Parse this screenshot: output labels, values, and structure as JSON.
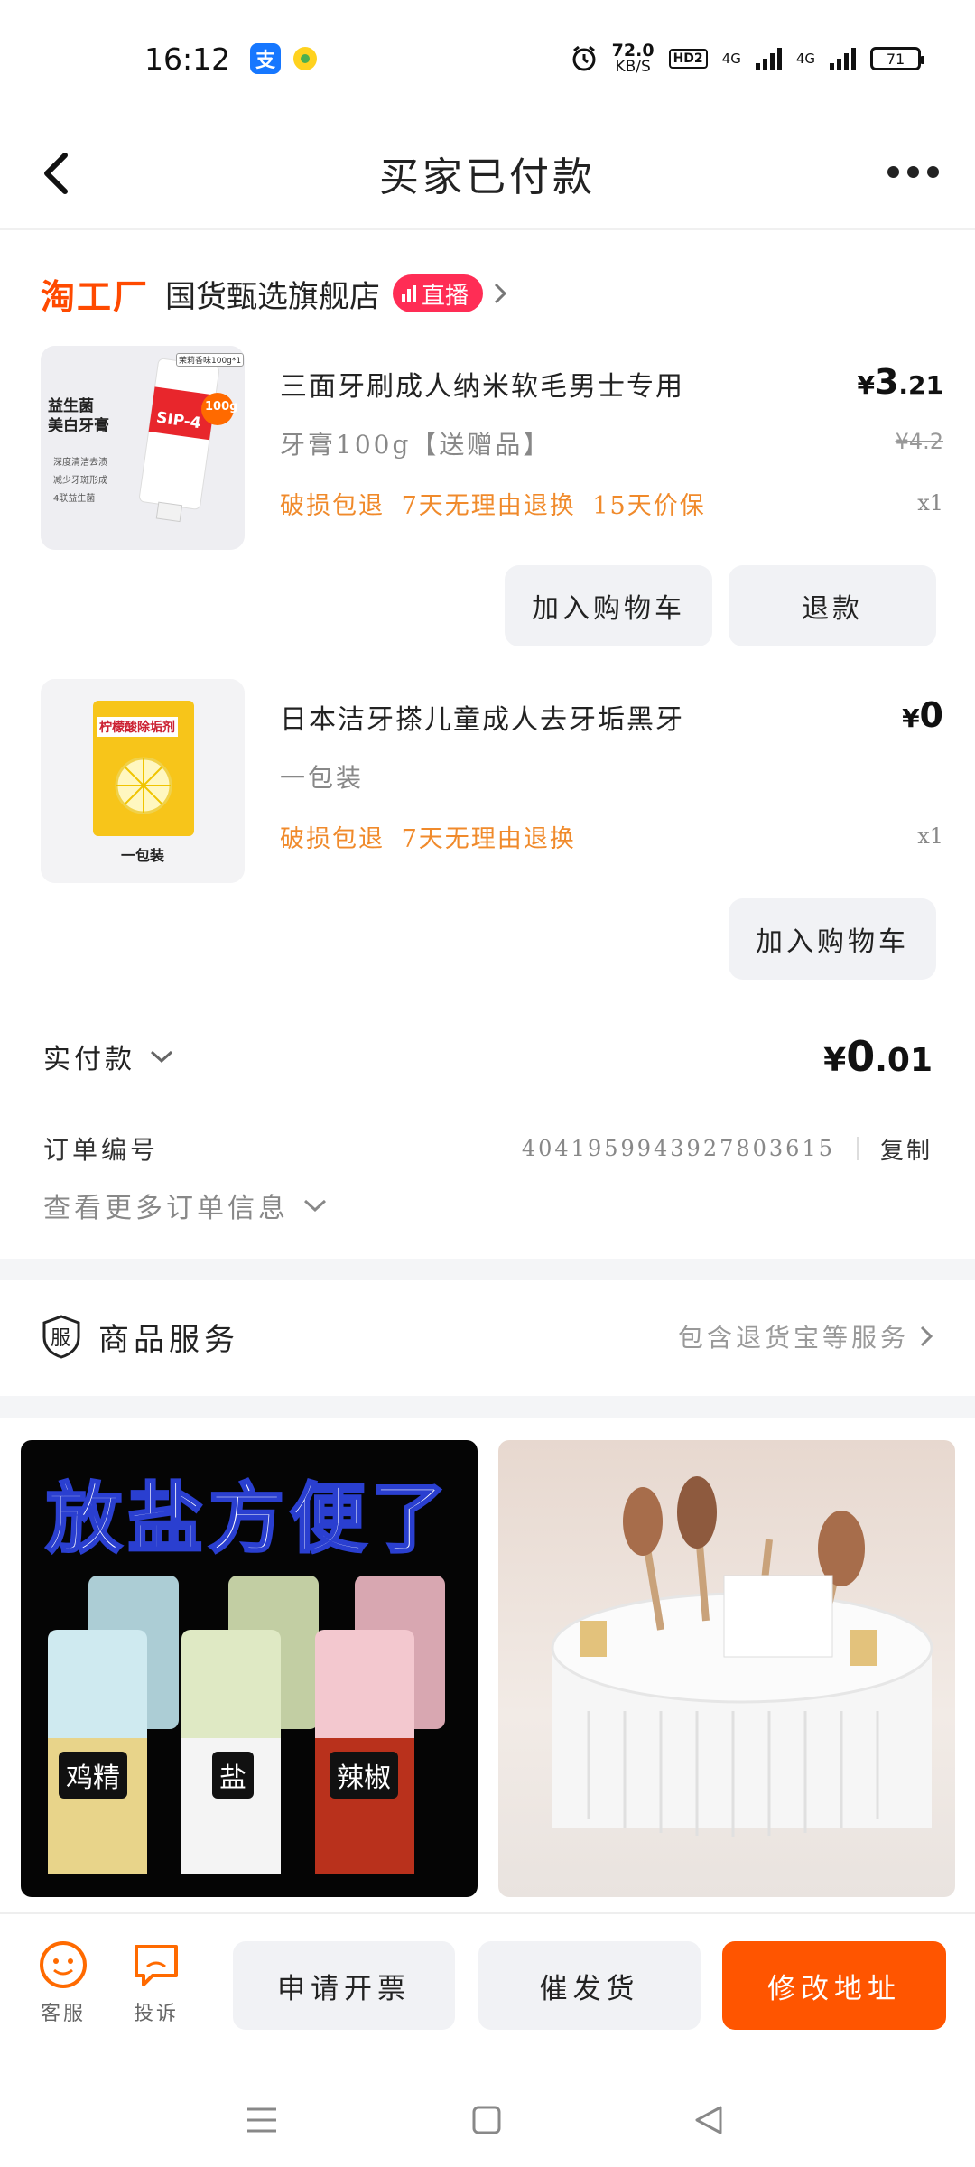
{
  "status_bar": {
    "time": "16:12",
    "net_speed_value": "72.0",
    "net_speed_unit": "KB/S",
    "hd_label": "HD2",
    "sim1_label": "4G",
    "sim2_label": "4G",
    "battery": "71",
    "icons": [
      "alipay-icon",
      "app-notification-icon",
      "alarm-icon",
      "signal-icon",
      "battery-icon"
    ]
  },
  "header": {
    "title": "买家已付款",
    "back_icon": "chevron-left-icon",
    "more_icon": "more-dots-icon"
  },
  "store": {
    "brand": "淘工厂",
    "name": "国货甄选旗舰店",
    "live_label": "直播",
    "live_color": "#ff2d55"
  },
  "items": [
    {
      "title": "三面牙刷成人纳米软毛男士专用",
      "spec": "牙膏100g【送赠品】",
      "tags": "破损包退 7天无理由退换 15天价保",
      "price_symbol": "¥",
      "price_int": "3",
      "price_dec": ".21",
      "original_price": "¥4.2",
      "qty": "x1",
      "thumb": {
        "line1": "益生菌",
        "line2": "美白牙膏",
        "badge": "SIP-4",
        "weight": "100g",
        "top_tag": "茉莉香味100g*1",
        "features": [
          "深度清洁去渍",
          "减少牙斑形成",
          "4联益生菌"
        ]
      },
      "buttons": [
        "加入购物车",
        "退款"
      ]
    },
    {
      "title": "日本洁牙搽儿童成人去牙垢黑牙",
      "spec": "一包装",
      "tags": "破损包退 7天无理由退换",
      "price_symbol": "¥",
      "price_int": "0",
      "price_dec": "",
      "qty": "x1",
      "thumb": {
        "package_text": "柠檬酸除垢剂",
        "caption": "一包装"
      },
      "buttons": [
        "加入购物车"
      ]
    }
  ],
  "summary": {
    "paid_label": "实付款",
    "paid_symbol": "¥",
    "paid_int": "0",
    "paid_dec": ".01",
    "order_no_label": "订单编号",
    "order_no": "4041959943927803615",
    "copy_label": "复制",
    "more_info_label": "查看更多订单信息"
  },
  "service": {
    "icon_char": "服",
    "label": "商品服务",
    "desc": "包含退货宝等服务"
  },
  "recommendations": [
    {
      "banner": "放盐方便了",
      "jar_labels": [
        "鸡精",
        "盐",
        "辣椒"
      ]
    },
    {
      "description_icon": "makeup-organizer-image"
    }
  ],
  "bottom_bar": {
    "service_label": "客服",
    "complaint_label": "投诉",
    "buttons": [
      "申请开票",
      "催发货",
      "修改地址"
    ],
    "accent": "#ff5500"
  },
  "nav": {
    "icons": [
      "menu-icon",
      "home-icon",
      "back-triangle-icon"
    ]
  }
}
